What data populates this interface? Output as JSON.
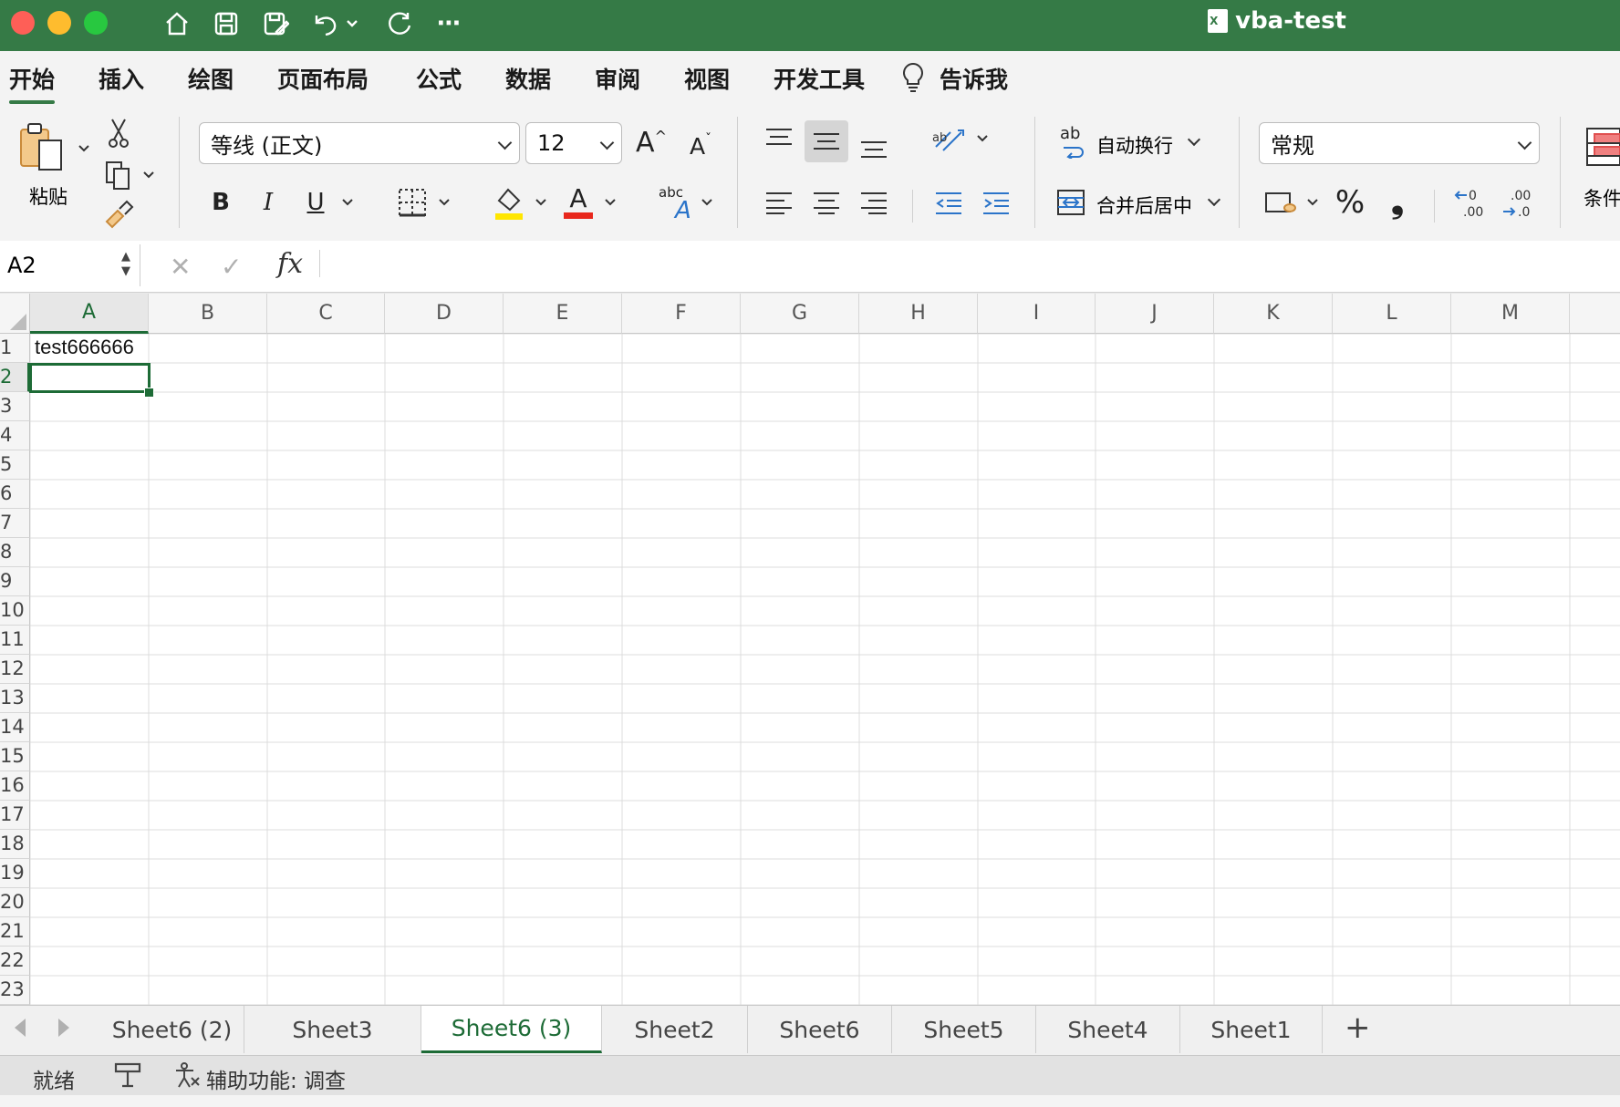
{
  "window": {
    "title": "vba-test"
  },
  "menu_tabs": [
    "开始",
    "插入",
    "绘图",
    "页面布局",
    "公式",
    "数据",
    "审阅",
    "视图",
    "开发工具",
    "告诉我"
  ],
  "ribbon": {
    "paste_label": "粘贴",
    "font_name": "等线 (正文)",
    "font_size": "12",
    "wrap_text_label": "自动换行",
    "merge_center_label": "合并后居中",
    "number_format": "常规",
    "conditional_label": "条件",
    "bold_glyph": "B",
    "italic_glyph": "I",
    "underline_glyph": "U",
    "percent_glyph": "%",
    "comma_glyph": "❟",
    "inc_font_glyph": "A",
    "dec_font_glyph": "A",
    "font_color_glyph": "A",
    "font_color": "#e8271c",
    "fill_color": "#ffe600",
    "abc_glyph": "abc",
    "wrap_glyph": "ab"
  },
  "formula_bar": {
    "name_box": "A2",
    "fx_label": "fx",
    "formula": ""
  },
  "columns": [
    "A",
    "B",
    "C",
    "D",
    "E",
    "F",
    "G",
    "H",
    "I",
    "J",
    "K",
    "L",
    "M"
  ],
  "selected_column": "A",
  "rows": [
    "1",
    "2",
    "3",
    "4",
    "5",
    "6",
    "7",
    "8",
    "9",
    "10",
    "11",
    "12",
    "13",
    "14",
    "15",
    "16",
    "17",
    "18",
    "19",
    "20",
    "21",
    "22",
    "23"
  ],
  "selected_row": "2",
  "cells": {
    "A1": "test666666"
  },
  "sheets": [
    "Sheet6 (2)",
    "Sheet3",
    "Sheet6 (3)",
    "Sheet2",
    "Sheet6",
    "Sheet5",
    "Sheet4",
    "Sheet1"
  ],
  "active_sheet": "Sheet6 (3)",
  "add_sheet_glyph": "+",
  "status": {
    "ready": "就绪",
    "accessibility": "辅助功能: 调查"
  },
  "colors": {
    "accent": "#357a46",
    "selection": "#1d6b36"
  }
}
